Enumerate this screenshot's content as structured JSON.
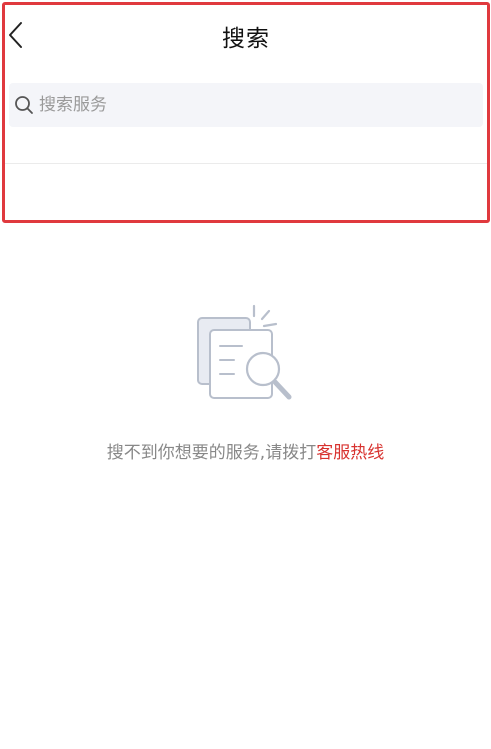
{
  "header": {
    "title": "搜索"
  },
  "search": {
    "placeholder": "搜索服务",
    "value": ""
  },
  "empty_state": {
    "message": "搜不到你想要的服务,请拨打",
    "link_label": "客服热线"
  },
  "colors": {
    "highlight_border": "#e0393e",
    "search_bg": "#f4f5f9",
    "link": "#d8322f",
    "muted_text": "#888888",
    "icon_gray": "#b8bfcc"
  },
  "icons": {
    "back": "chevron-left-icon",
    "search": "search-icon",
    "empty": "document-search-icon"
  }
}
